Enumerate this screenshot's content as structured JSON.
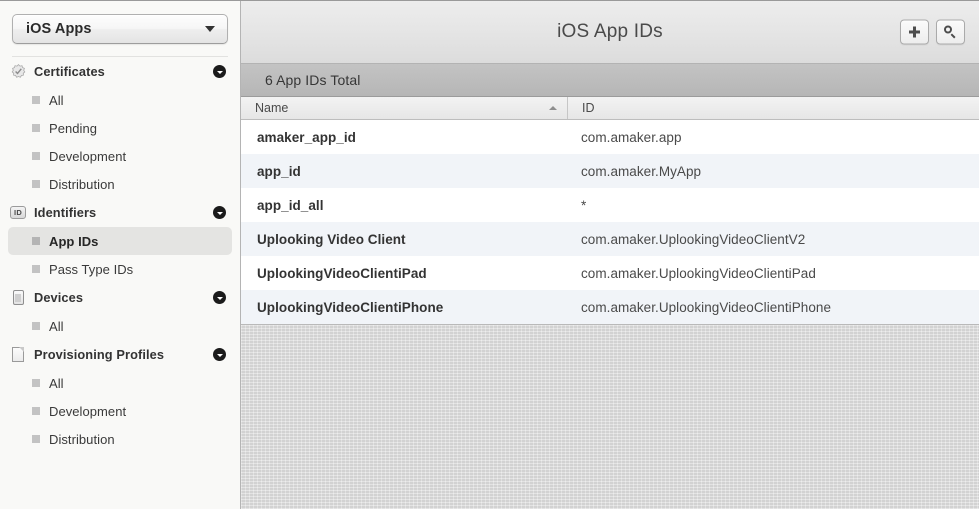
{
  "sidebar": {
    "team_select": {
      "label": "iOS Apps",
      "caret_icon": "chevron-down-icon"
    },
    "groups": [
      {
        "title": "Certificates",
        "icon": "certificate-seal-icon",
        "disclosure_icon": "disclosure-collapse-icon",
        "items": [
          {
            "label": "All",
            "selected": false
          },
          {
            "label": "Pending",
            "selected": false
          },
          {
            "label": "Development",
            "selected": false
          },
          {
            "label": "Distribution",
            "selected": false
          }
        ]
      },
      {
        "title": "Identifiers",
        "icon": "id-badge-icon",
        "disclosure_icon": "disclosure-collapse-icon",
        "items": [
          {
            "label": "App IDs",
            "selected": true
          },
          {
            "label": "Pass Type IDs",
            "selected": false
          }
        ]
      },
      {
        "title": "Devices",
        "icon": "device-phone-icon",
        "disclosure_icon": "disclosure-collapse-icon",
        "items": [
          {
            "label": "All",
            "selected": false
          }
        ]
      },
      {
        "title": "Provisioning Profiles",
        "icon": "document-icon",
        "disclosure_icon": "disclosure-collapse-icon",
        "items": [
          {
            "label": "All",
            "selected": false
          },
          {
            "label": "Development",
            "selected": false
          },
          {
            "label": "Distribution",
            "selected": false
          }
        ]
      }
    ]
  },
  "toolbar": {
    "title": "iOS App IDs",
    "add_button": {
      "label": "+",
      "icon": "plus-icon"
    },
    "search_button": {
      "label": "",
      "icon": "search-icon"
    }
  },
  "status": {
    "text": "6 App IDs Total"
  },
  "table": {
    "columns": [
      {
        "label": "Name",
        "sort": "asc",
        "sort_icon": "sort-ascending-icon"
      },
      {
        "label": "ID",
        "sort": "none"
      }
    ],
    "rows": [
      {
        "name": "amaker_app_id",
        "id": "com.amaker.app"
      },
      {
        "name": "app_id",
        "id": "com.amaker.MyApp"
      },
      {
        "name": "app_id_all",
        "id": "*"
      },
      {
        "name": "Uplooking Video Client",
        "id": "com.amaker.UplookingVideoClientV2"
      },
      {
        "name": "UplookingVideoClientiPad",
        "id": "com.amaker.UplookingVideoClientiPad"
      },
      {
        "name": "UplookingVideoClientiPhone",
        "id": "com.amaker.UplookingVideoClientiPhone"
      }
    ]
  },
  "colors": {
    "sidebar_bg": "#f9f9f7",
    "selected_item_bg": "#e4e4e2",
    "row_alt_bg": "#f1f4f8",
    "status_bar_bg": "#b9b9b9",
    "content_bg": "#d7d7d7",
    "toolbar_bg": "#e5e5e5"
  }
}
